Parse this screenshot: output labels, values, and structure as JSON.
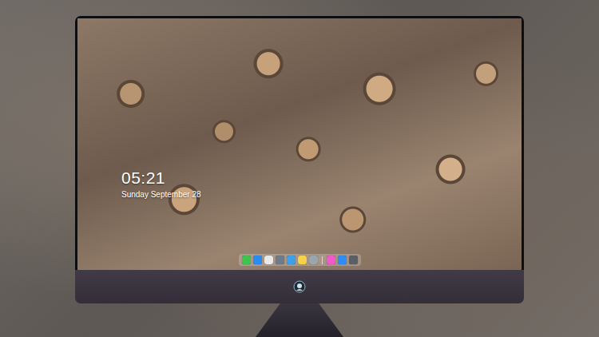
{
  "desktop": {
    "clock": {
      "time": "05:21",
      "date": "Sunday September 28"
    }
  },
  "dock": {
    "items": [
      {
        "color": "#3fc34f"
      },
      {
        "color": "#2a8cf0"
      },
      {
        "color": "#e9e9e9"
      },
      {
        "color": "#6d7b8a"
      },
      {
        "color": "#3da0e8"
      },
      {
        "color": "#f4d34a"
      },
      {
        "color": "#9aa5ad"
      },
      {
        "color": "#f05ac8"
      },
      {
        "color": "#2f8cf5"
      },
      {
        "color": "#5a5f66"
      }
    ]
  }
}
